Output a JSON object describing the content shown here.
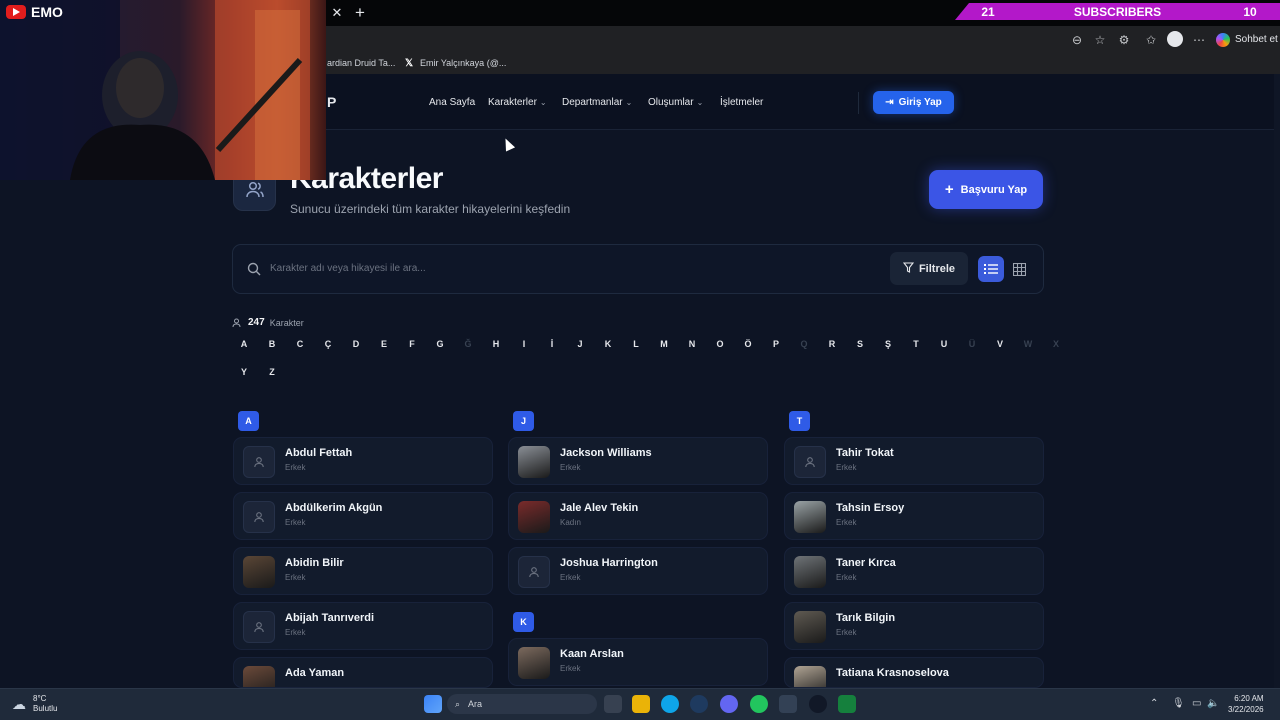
{
  "overlay": {
    "subscribers_label": "SUBSCRIBERS",
    "count_left": "21",
    "count_right": "10",
    "streamer": "EMO"
  },
  "browser": {
    "bookmarks": [
      "ardian Druid Ta...",
      "Emir Yalçınkaya (@..."
    ],
    "sohbet": "Sohbet et"
  },
  "nav": {
    "logo_fragment": "P",
    "items": [
      {
        "label": "Ana Sayfa"
      },
      {
        "label": "Karakterler"
      },
      {
        "label": "Departmanlar"
      },
      {
        "label": "Oluşumlar"
      },
      {
        "label": "İşletmeler"
      }
    ],
    "login": "Giriş Yap"
  },
  "header": {
    "title": "Karakterler",
    "subtitle": "Sunucu üzerindeki tüm karakter hikayelerini keşfedin",
    "apply": "Başvuru Yap"
  },
  "search": {
    "placeholder": "Karakter adı veya hikayesi ile ara...",
    "filter": "Filtrele"
  },
  "count": {
    "value": "247",
    "label": "Karakter"
  },
  "letters": [
    {
      "l": "A",
      "on": true
    },
    {
      "l": "B",
      "on": true
    },
    {
      "l": "C",
      "on": true
    },
    {
      "l": "Ç",
      "on": true
    },
    {
      "l": "D",
      "on": true
    },
    {
      "l": "E",
      "on": true
    },
    {
      "l": "F",
      "on": true
    },
    {
      "l": "G",
      "on": true
    },
    {
      "l": "Ğ",
      "on": false
    },
    {
      "l": "H",
      "on": true
    },
    {
      "l": "I",
      "on": true
    },
    {
      "l": "İ",
      "on": true
    },
    {
      "l": "J",
      "on": true
    },
    {
      "l": "K",
      "on": true
    },
    {
      "l": "L",
      "on": true
    },
    {
      "l": "M",
      "on": true
    },
    {
      "l": "N",
      "on": true
    },
    {
      "l": "O",
      "on": true
    },
    {
      "l": "Ö",
      "on": true
    },
    {
      "l": "P",
      "on": true
    },
    {
      "l": "Q",
      "on": false
    },
    {
      "l": "R",
      "on": true
    },
    {
      "l": "S",
      "on": true
    },
    {
      "l": "Ş",
      "on": true
    },
    {
      "l": "T",
      "on": true
    },
    {
      "l": "U",
      "on": true
    },
    {
      "l": "Ü",
      "on": false
    },
    {
      "l": "V",
      "on": true
    },
    {
      "l": "W",
      "on": false
    },
    {
      "l": "X",
      "on": false
    },
    {
      "l": "Y",
      "on": true
    },
    {
      "l": "Z",
      "on": true
    }
  ],
  "columns": [
    {
      "groups": [
        {
          "letter": "A",
          "items": [
            {
              "name": "Abdul Fettah",
              "gender": "Erkek",
              "photo": false
            },
            {
              "name": "Abdülkerim Akgün",
              "gender": "Erkek",
              "photo": false
            },
            {
              "name": "Abidin Bilir",
              "gender": "Erkek",
              "photo": true,
              "color": "#5a4636"
            },
            {
              "name": "Abijah Tanrıverdi",
              "gender": "Erkek",
              "photo": false
            },
            {
              "name": "Ada Yaman",
              "gender": "",
              "photo": true,
              "color": "#6b4a3a"
            }
          ]
        }
      ]
    },
    {
      "groups": [
        {
          "letter": "J",
          "items": [
            {
              "name": "Jackson Williams",
              "gender": "Erkek",
              "photo": true,
              "color": "#8a8f96"
            },
            {
              "name": "Jale Alev Tekin",
              "gender": "Kadın",
              "photo": true,
              "color": "#7a2b2b"
            },
            {
              "name": "Joshua Harrington",
              "gender": "Erkek",
              "photo": false
            }
          ]
        },
        {
          "letter": "K",
          "items": [
            {
              "name": "Kaan Arslan",
              "gender": "Erkek",
              "photo": true,
              "color": "#7c6a5e"
            }
          ]
        }
      ]
    },
    {
      "groups": [
        {
          "letter": "T",
          "items": [
            {
              "name": "Tahir Tokat",
              "gender": "Erkek",
              "photo": false
            },
            {
              "name": "Tahsin Ersoy",
              "gender": "Erkek",
              "photo": true,
              "color": "#9aa3a6"
            },
            {
              "name": "Taner Kırca",
              "gender": "Erkek",
              "photo": true,
              "color": "#6f7478"
            },
            {
              "name": "Tarık Bilgin",
              "gender": "Erkek",
              "photo": true,
              "color": "#5f5a52"
            },
            {
              "name": "Tatiana Krasnoselova",
              "gender": "",
              "photo": true,
              "color": "#b0a494"
            }
          ]
        }
      ]
    }
  ],
  "taskbar": {
    "temp": "8°C",
    "weather": "Bulutlu",
    "search": "Ara",
    "time": "6:20 AM",
    "date": "3/22/2026"
  }
}
